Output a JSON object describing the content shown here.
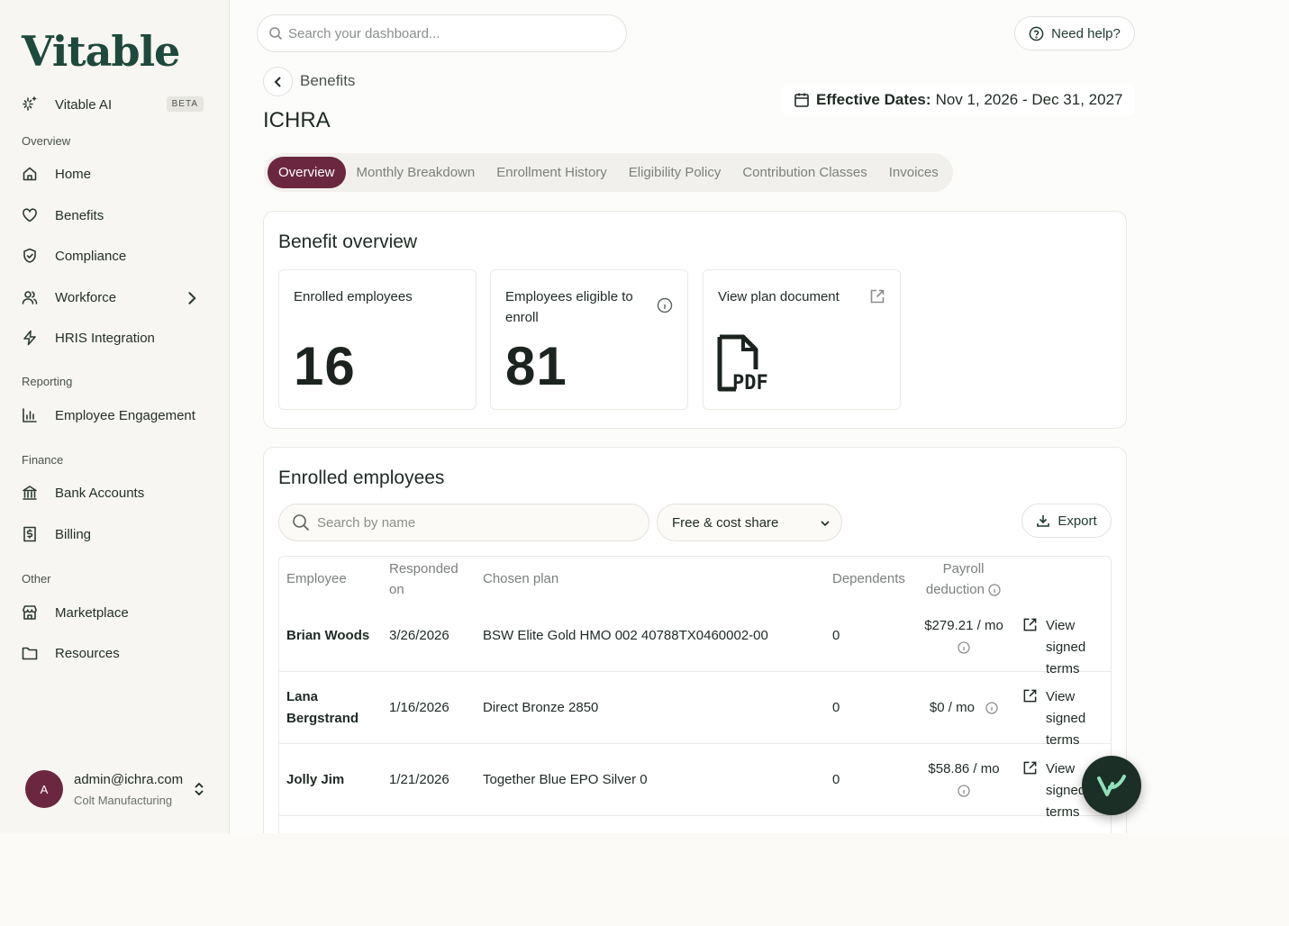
{
  "sidebar": {
    "logo": "Vitable",
    "ai_item": {
      "label": "Vitable AI",
      "badge": "BETA"
    },
    "sections": [
      {
        "label": "Overview",
        "items": [
          "Home",
          "Benefits",
          "Compliance",
          "Workforce",
          "HRIS Integration"
        ]
      },
      {
        "label": "Reporting",
        "items": [
          "Employee Engagement"
        ]
      },
      {
        "label": "Finance",
        "items": [
          "Bank Accounts",
          "Billing"
        ]
      },
      {
        "label": "Other",
        "items": [
          "Marketplace",
          "Resources"
        ]
      }
    ],
    "user": {
      "initial": "A",
      "email": "admin@ichra.com",
      "org": "Colt Manufacturing"
    }
  },
  "header": {
    "search_placeholder": "Search your dashboard...",
    "help_label": "Need help?"
  },
  "page": {
    "breadcrumb": "Benefits",
    "title": "ICHRA",
    "effective_label": "Effective Dates:",
    "effective_value": "Nov 1, 2026 - Dec 31, 2027",
    "tabs": [
      "Overview",
      "Monthly Breakdown",
      "Enrollment History",
      "Eligibility Policy",
      "Contribution Classes",
      "Invoices"
    ],
    "active_tab": "Overview"
  },
  "overview": {
    "title": "Benefit overview",
    "enrolled_label": "Enrolled employees",
    "enrolled_value": "16",
    "eligible_label": "Employees eligible to enroll",
    "eligible_value": "81",
    "plan_doc_label": "View plan document"
  },
  "enrolled": {
    "title": "Enrolled employees",
    "search_placeholder": "Search by name",
    "filter_value": "Free & cost share",
    "export_label": "Export",
    "columns": {
      "employee": "Employee",
      "responded": "Responded on",
      "plan": "Chosen plan",
      "dependents": "Dependents",
      "payroll": "Payroll deduction"
    },
    "rows": [
      {
        "name": "Brian Woods",
        "responded": "3/26/2026",
        "plan": "BSW Elite Gold HMO 002 40788TX0460002-00",
        "dependents": "0",
        "deduction": "$279.21 / mo",
        "action": "View signed terms"
      },
      {
        "name": "Lana Bergstrand",
        "responded": "1/16/2026",
        "plan": "Direct Bronze 2850",
        "dependents": "0",
        "deduction": "$0 / mo",
        "action": "View signed terms"
      },
      {
        "name": "Jolly Jim",
        "responded": "1/21/2026",
        "plan": "Together Blue EPO Silver 0",
        "dependents": "0",
        "deduction": "$58.86 / mo",
        "action": "View signed terms"
      }
    ]
  },
  "colors": {
    "accent": "#6b2740",
    "brand": "#1d4a3c"
  }
}
